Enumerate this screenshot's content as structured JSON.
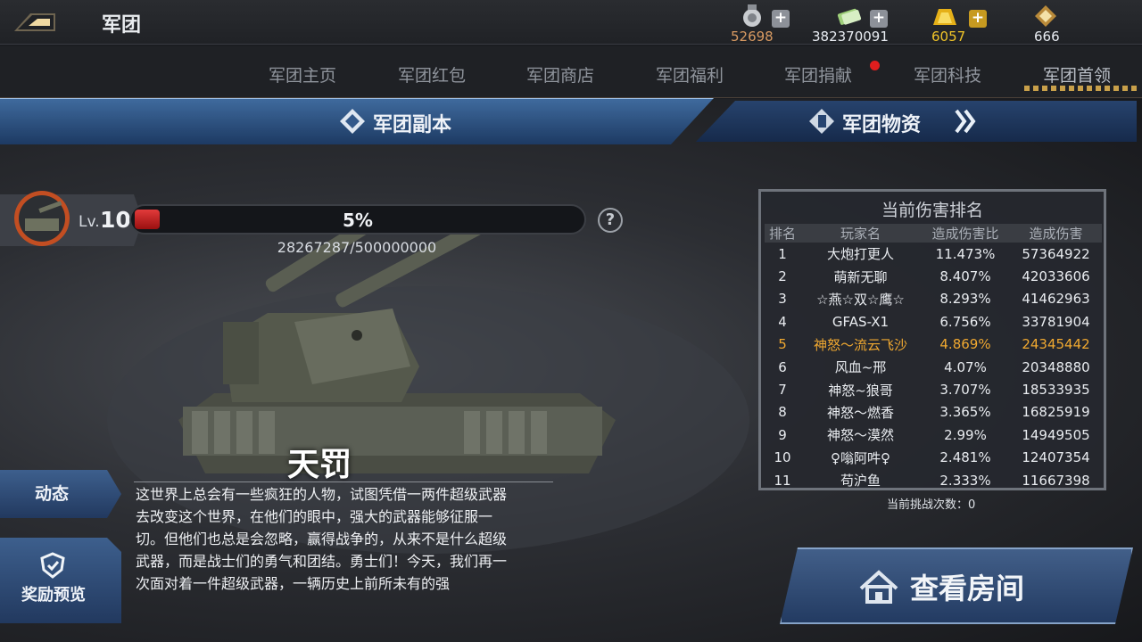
{
  "header": {
    "title": "军团"
  },
  "resources": [
    {
      "name": "silver-medal",
      "value": "52698",
      "color": "#d89a62",
      "plus": true
    },
    {
      "name": "cash",
      "value": "382370091",
      "color": "#e8ecf2",
      "plus": true
    },
    {
      "name": "gold",
      "value": "6057",
      "color": "#f0c428",
      "plus": true
    },
    {
      "name": "gem",
      "value": "666",
      "color": "#e8ecf2",
      "plus": false
    }
  ],
  "tabs": [
    "军团主页",
    "军团红包",
    "军团商店",
    "军团福利",
    "军团捐献",
    "军团科技",
    "军团首领"
  ],
  "active_tab": "军团首领",
  "banners": {
    "left": "军团副本",
    "right": "军团物资"
  },
  "boss": {
    "level_prefix": "Lv.",
    "level": "10",
    "hp_percent_text": "5%",
    "hp_fraction": 0.0565,
    "hp_text": "28267287/500000000",
    "name": "天罚",
    "description": "这世界上总会有一些疯狂的人物，试图凭借一两件超级武器去改变这个世界，在他们的眼中，强大的武器能够征服一切。但他们也总是会忽略，赢得战争的，从来不是什么超级武器，而是战士们的勇气和团结。勇士们！今天，我们再一次面对着一件超级武器，一辆历史上前所未有的强"
  },
  "side": {
    "dynamic": "动态",
    "reward": "奖励预览"
  },
  "ranking": {
    "title": "当前伤害排名",
    "columns": [
      "排名",
      "玩家名",
      "造成伤害比",
      "造成伤害"
    ],
    "rows": [
      [
        "1",
        "大炮打更人",
        "11.473%",
        "57364922"
      ],
      [
        "2",
        "萌新无聊",
        "8.407%",
        "42033606"
      ],
      [
        "3",
        "☆燕☆双☆鹰☆",
        "8.293%",
        "41462963"
      ],
      [
        "4",
        "GFAS-X1",
        "6.756%",
        "33781904"
      ],
      [
        "5",
        "神怒～流云飞沙",
        "4.869%",
        "24345442"
      ],
      [
        "6",
        "风血~邢",
        "4.07%",
        "20348880"
      ],
      [
        "7",
        "神怒~狼哥",
        "3.707%",
        "18533935"
      ],
      [
        "8",
        "神怒～燃香",
        "3.365%",
        "16825919"
      ],
      [
        "9",
        "神怒～漠然",
        "2.99%",
        "14949505"
      ],
      [
        "10",
        "♀嗡阿吽♀",
        "2.481%",
        "12407354"
      ],
      [
        "11",
        "苟沪鱼",
        "2.333%",
        "11667398"
      ]
    ],
    "highlight_rank": "5",
    "challenge_text": "当前挑战次数：0"
  },
  "room_button": "查看房间"
}
